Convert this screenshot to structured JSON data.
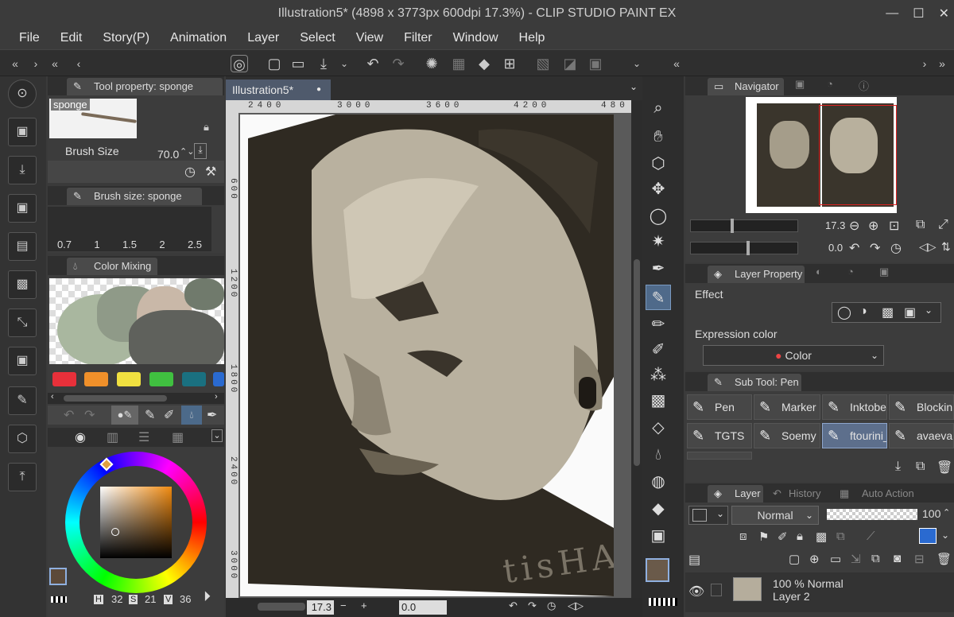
{
  "window": {
    "title": "Illustration5* (4898 x 3773px 600dpi 17.3%)  - CLIP STUDIO PAINT EX",
    "minimize": "—",
    "maximize": "☐",
    "close": "✕"
  },
  "menu": [
    "File",
    "Edit",
    "Story(P)",
    "Animation",
    "Layer",
    "Select",
    "View",
    "Filter",
    "Window",
    "Help"
  ],
  "tool_property": {
    "tab": "Tool property: sponge",
    "brush_name": "sponge",
    "brush_size_label": "Brush Size",
    "brush_size_value": "70.0"
  },
  "brush_size_panel": {
    "tab": "Brush size: sponge",
    "sizes": [
      "0.7",
      "1",
      "1.5",
      "2",
      "2.5"
    ]
  },
  "color_mixing": {
    "tab": "Color Mixing"
  },
  "palette_colors": [
    "#e8303a",
    "#f0902a",
    "#f0e040",
    "#40c040",
    "#1a7080",
    "#2a6ad0"
  ],
  "color_wheel": {
    "h_label": "H",
    "h": "32",
    "s_label": "S",
    "s": "21",
    "v_label": "V",
    "v": "36",
    "main_color": "#5c4a3a"
  },
  "canvas": {
    "doc_tab": "Illustration5*",
    "ruler_labels": [
      "2400",
      "3000",
      "3600",
      "4200",
      "480"
    ],
    "vruler_labels": [
      "600",
      "1200",
      "1800",
      "2400",
      "3000"
    ],
    "zoom": "17.3",
    "rotation": "0.0",
    "signature": "tisHA"
  },
  "navigator": {
    "tab": "Navigator",
    "zoom": "17.3",
    "angle": "0.0"
  },
  "layer_property": {
    "tab": "Layer Property",
    "effect_label": "Effect",
    "expression_color_label": "Expression color",
    "expression_color_value": "Color"
  },
  "sub_tool": {
    "tab": "Sub Tool: Pen",
    "items": [
      "Pen",
      "Marker",
      "Inktobe",
      "Blockin",
      "TGTS",
      "Soemy",
      "ftourini_",
      "avaeva"
    ]
  },
  "layer": {
    "tab": "Layer",
    "history_tab": "History",
    "auto_action_tab": "Auto Action",
    "blend_mode": "Normal",
    "opacity": "100",
    "layer_entry_mode": "100 % Normal",
    "layer_entry_name": "Layer 2"
  }
}
